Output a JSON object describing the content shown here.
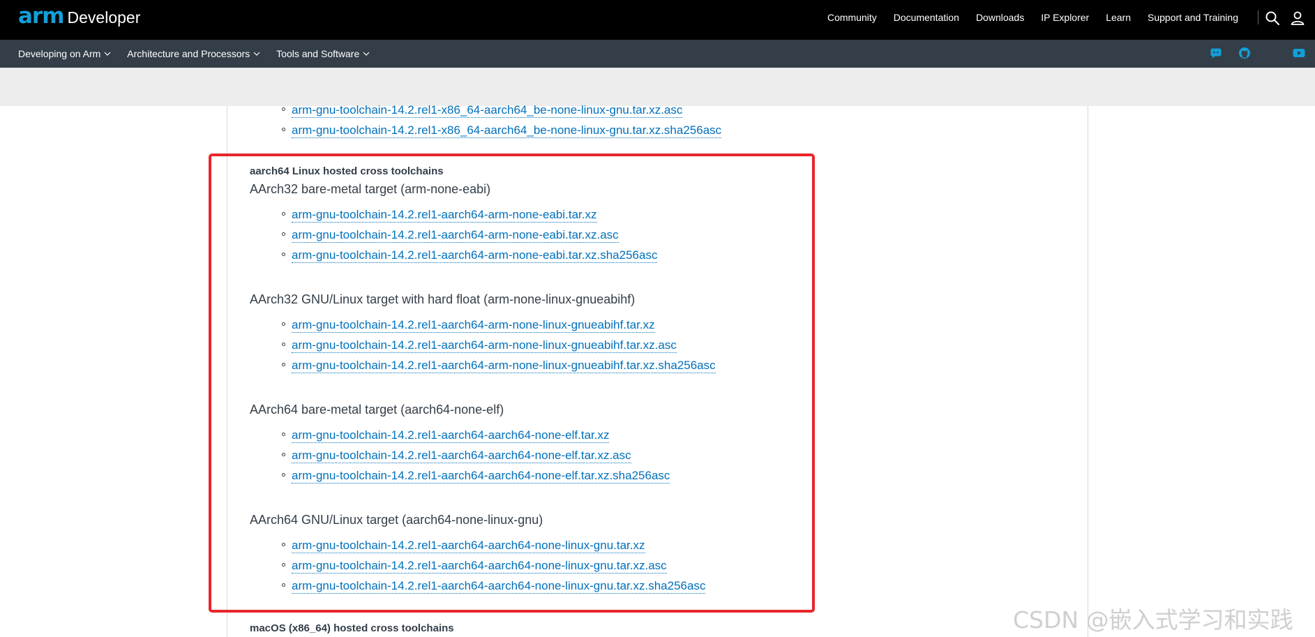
{
  "header": {
    "logo_arm": "arm",
    "logo_developer": "Developer",
    "nav": [
      "Community",
      "Documentation",
      "Downloads",
      "IP Explorer",
      "Learn",
      "Support and Training"
    ],
    "icons": [
      "search-icon",
      "user-icon"
    ]
  },
  "subnav": {
    "items": [
      "Developing on Arm",
      "Architecture and Processors",
      "Tools and Software"
    ],
    "icons": [
      "discord-icon",
      "github-icon",
      "youtube-icon"
    ]
  },
  "prev_links": [
    "arm-gnu-toolchain-14.2.rel1-x86_64-aarch64_be-none-linux-gnu.tar.xz.asc",
    "arm-gnu-toolchain-14.2.rel1-x86_64-aarch64_be-none-linux-gnu.tar.xz.sha256asc"
  ],
  "section": {
    "title": "aarch64 Linux hosted cross toolchains",
    "groups": [
      {
        "heading": "AArch32 bare-metal target (arm-none-eabi)",
        "links": [
          "arm-gnu-toolchain-14.2.rel1-aarch64-arm-none-eabi.tar.xz",
          "arm-gnu-toolchain-14.2.rel1-aarch64-arm-none-eabi.tar.xz.asc",
          "arm-gnu-toolchain-14.2.rel1-aarch64-arm-none-eabi.tar.xz.sha256asc"
        ]
      },
      {
        "heading": "AArch32 GNU/Linux target with hard float (arm-none-linux-gnueabihf)",
        "links": [
          "arm-gnu-toolchain-14.2.rel1-aarch64-arm-none-linux-gnueabihf.tar.xz",
          "arm-gnu-toolchain-14.2.rel1-aarch64-arm-none-linux-gnueabihf.tar.xz.asc",
          "arm-gnu-toolchain-14.2.rel1-aarch64-arm-none-linux-gnueabihf.tar.xz.sha256asc"
        ]
      },
      {
        "heading": "AArch64 bare-metal target (aarch64-none-elf)",
        "links": [
          "arm-gnu-toolchain-14.2.rel1-aarch64-aarch64-none-elf.tar.xz",
          "arm-gnu-toolchain-14.2.rel1-aarch64-aarch64-none-elf.tar.xz.asc",
          "arm-gnu-toolchain-14.2.rel1-aarch64-aarch64-none-elf.tar.xz.sha256asc"
        ]
      },
      {
        "heading": "AArch64 GNU/Linux target (aarch64-none-linux-gnu)",
        "links": [
          "arm-gnu-toolchain-14.2.rel1-aarch64-aarch64-none-linux-gnu.tar.xz",
          "arm-gnu-toolchain-14.2.rel1-aarch64-aarch64-none-linux-gnu.tar.xz.asc",
          "arm-gnu-toolchain-14.2.rel1-aarch64-aarch64-none-linux-gnu.tar.xz.sha256asc"
        ]
      }
    ]
  },
  "next_section_title": "macOS (x86_64) hosted cross toolchains",
  "watermark": "CSDN @嵌入式学习和实践",
  "colors": {
    "link": "#0070bb",
    "highlight_box": "#e8262b",
    "header_bg": "#000000",
    "subnav_bg": "#333e48",
    "brand": "#11a0d9"
  }
}
